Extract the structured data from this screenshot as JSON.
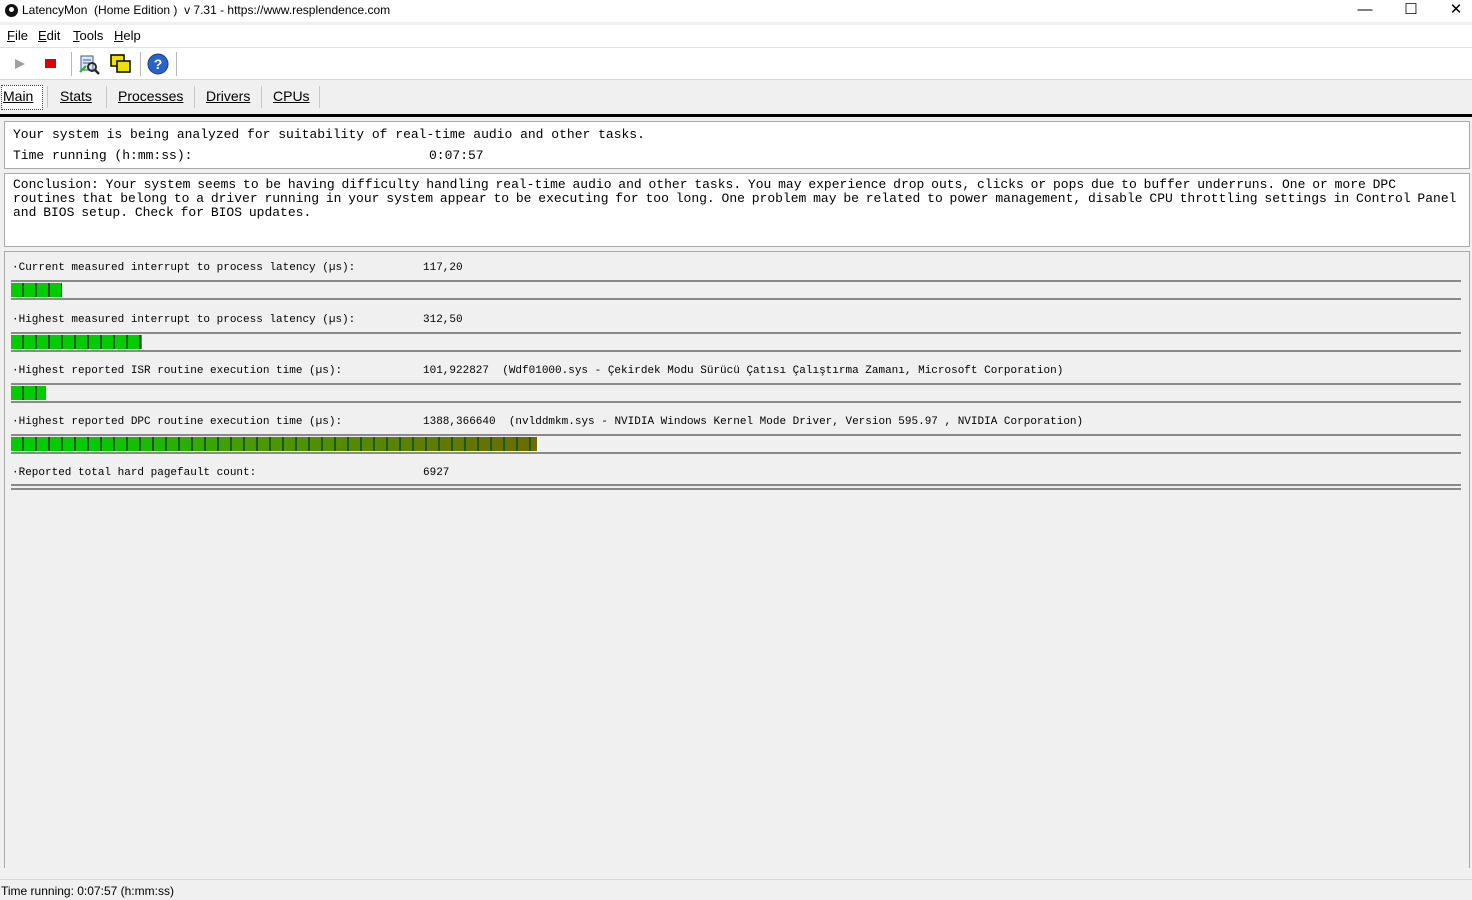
{
  "window": {
    "title": "LatencyMon  (Home Edition )  v 7.31 - https://www.resplendence.com",
    "minimize": "—",
    "maximize": "☐",
    "close": "✕"
  },
  "menu": {
    "file": {
      "key": "F",
      "rest": "ile"
    },
    "edit": {
      "key": "E",
      "rest": "dit"
    },
    "tools": {
      "key": "T",
      "rest": "ools"
    },
    "help": {
      "key": "H",
      "rest": "elp"
    }
  },
  "toolbar": {
    "icons": [
      "play-icon",
      "stop-icon",
      "report-icon",
      "copy-windows-icon",
      "help-icon"
    ]
  },
  "tabs": [
    "Main",
    "Stats",
    "Processes",
    "Drivers",
    "CPUs"
  ],
  "summary": {
    "analyzing": "Your system is being analyzed for suitability of real-time audio and other tasks.",
    "time_label": "Time running (h:mm:ss):",
    "time_value": "0:07:57"
  },
  "conclusion": "Conclusion: Your system seems to be having difficulty handling real-time audio and other tasks. You may experience drop outs, clicks or pops due to buffer underruns. One or more DPC routines that belong to a driver running in your system appear to be executing for too long. One problem may be related to power management, disable CPU throttling settings in Control Panel and BIOS setup. Check for BIOS updates.",
  "metrics": [
    {
      "label": "·Current measured interrupt to process latency (µs):",
      "value": "117,20",
      "detail": "",
      "bar_fraction": 0.035
    },
    {
      "label": "·Highest measured interrupt to process latency (µs):",
      "value": "312,50",
      "detail": "",
      "bar_fraction": 0.09
    },
    {
      "label": "·Highest reported ISR routine execution time (µs):",
      "value": "101,922827",
      "detail": "(Wdf01000.sys - Çekirdek Modu Sürücü Çatısı Çalıştırma Zamanı, Microsoft Corporation)",
      "bar_fraction": 0.024
    },
    {
      "label": "·Highest reported DPC routine execution time (µs):",
      "value": "1388,366640",
      "detail": "(nvlddmkm.sys - NVIDIA Windows Kernel Mode Driver, Version 595.97 , NVIDIA Corporation)",
      "bar_fraction": 0.363
    },
    {
      "label": "·Reported total hard pagefault count:",
      "value": "6927",
      "detail": "",
      "bar_fraction": 0
    }
  ],
  "colors": {
    "bar_green": "#00cc00",
    "bar_olive": "#6b6b00",
    "stop_red": "#e00000"
  },
  "status": "Time running: 0:07:57  (h:mm:ss)"
}
